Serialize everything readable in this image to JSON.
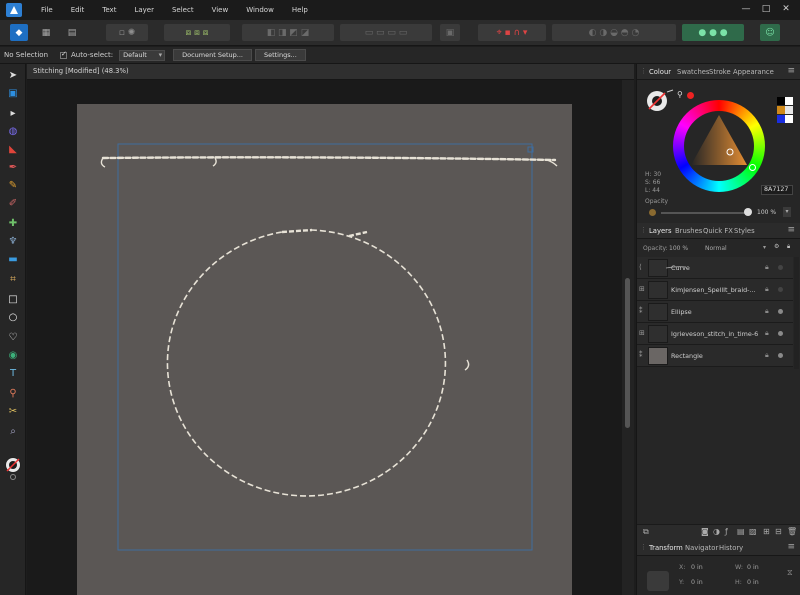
{
  "menu": [
    "File",
    "Edit",
    "Text",
    "Layer",
    "Select",
    "View",
    "Window",
    "Help"
  ],
  "window_controls": [
    "—",
    "□",
    "✕"
  ],
  "context": {
    "selection": "No Selection",
    "auto_select_label": "Auto-select:",
    "auto_select_value": "Default",
    "document_setup": "Document Setup...",
    "settings": "Settings..."
  },
  "document": {
    "title": "Stitching [Modified] (48.3%)"
  },
  "colour_panel": {
    "tabs": [
      "Colour",
      "Swatches",
      "Stroke",
      "Appearance"
    ],
    "hsl": [
      "H: 30",
      "S: 66",
      "L: 44"
    ],
    "hex": "8A7127",
    "opacity_label": "Opacity",
    "opacity_value": "100 %"
  },
  "layers_panel": {
    "tabs": [
      "Layers",
      "Brushes",
      "Quick FX",
      "Styles"
    ],
    "opacity_label": "Opacity:",
    "opacity_value": "100 %",
    "blend_mode": "Normal",
    "layers": [
      {
        "name": "Curve",
        "icon": "curve-layer-icon",
        "visible": false
      },
      {
        "name": "KimJensen_SpellIt_braid-...",
        "icon": "brush-stroke-layer-icon",
        "visible": false
      },
      {
        "name": "Ellipse",
        "icon": "shape-layer-icon",
        "visible": true
      },
      {
        "name": "Igrieveson_stitch_in_time-6",
        "icon": "brush-stroke-layer-icon",
        "visible": true
      },
      {
        "name": "Rectangle",
        "icon": "shape-layer-icon",
        "visible": true
      }
    ]
  },
  "transform_panel": {
    "tabs": [
      "Transform",
      "Navigator",
      "History"
    ],
    "fields": [
      {
        "label": "X:",
        "value": "0 in"
      },
      {
        "label": "W:",
        "value": "0 in"
      },
      {
        "label": "Y:",
        "value": "0 in"
      },
      {
        "label": "H:",
        "value": "0 in"
      }
    ]
  },
  "colors": {
    "accent": "#1e6fc3",
    "artboard": "#5b5755",
    "guide": "#3f6c9d",
    "stitch": "#e7e2d6",
    "current_colour": "#8A7127"
  }
}
